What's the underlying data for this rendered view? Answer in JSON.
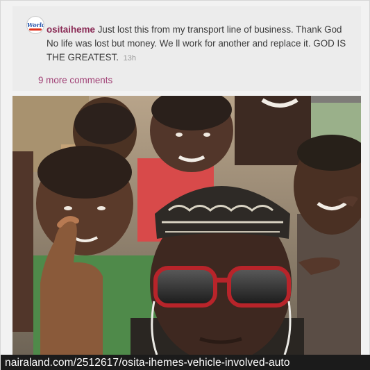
{
  "post": {
    "avatar_logo_text": "World",
    "username": "ositaiheme",
    "caption": "Just lost this from my transport line of business. Thank God No life was lost but money. We ll work for another and replace it. GOD IS THE GREATEST.",
    "time_ago": "13h",
    "more_comments": "9 more comments"
  },
  "photo": {
    "subject": "selfie-group-photo"
  },
  "footer": {
    "url": "nairaland.com/2512617/osita-ihemes-vehicle-involved-auto"
  },
  "colors": {
    "username": "#8a2a55",
    "link": "#a04075",
    "url_bar_background": "#1b1b1b"
  }
}
